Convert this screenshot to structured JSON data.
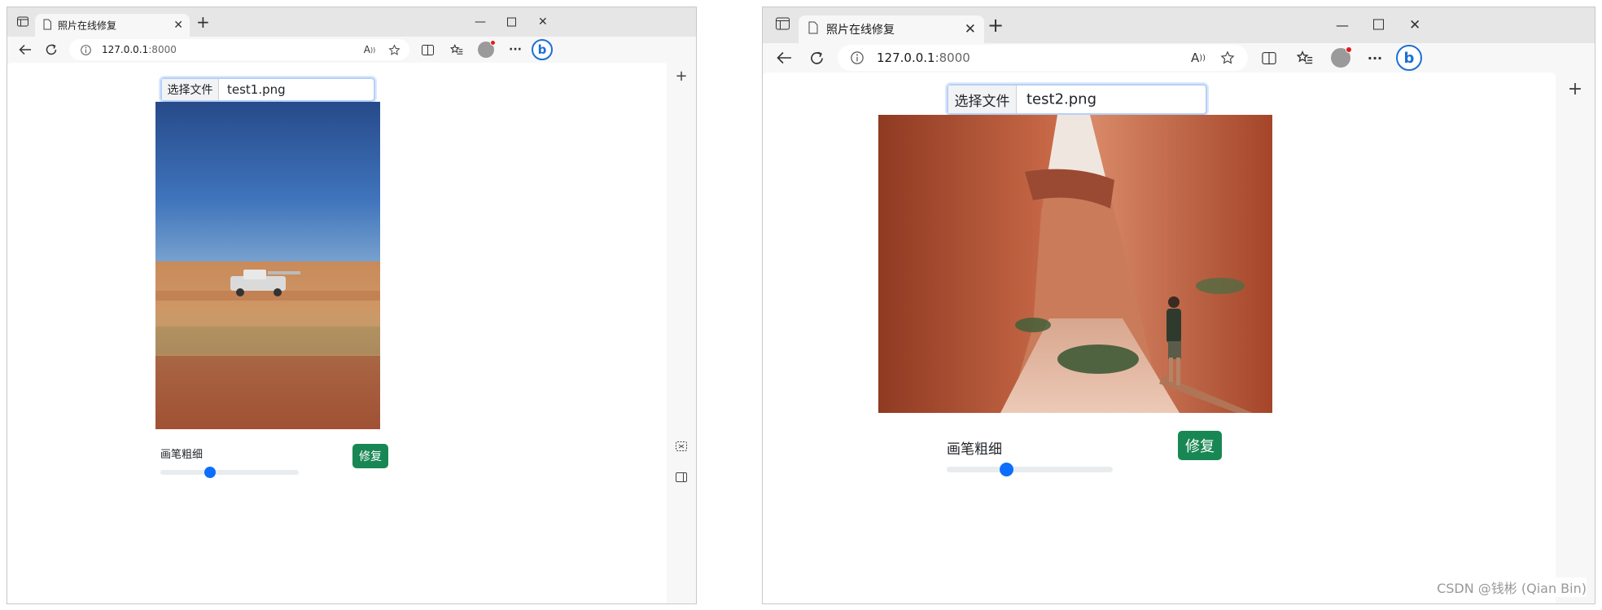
{
  "left_window": {
    "tab_title": "照片在线修复",
    "url_host": "127.0.0.1",
    "url_port": ":8000",
    "file_button_label": "选择文件",
    "file_name": "test1.png",
    "brush_label": "画笔粗细",
    "repair_button_label": "修复",
    "brush_value_fraction": 0.36
  },
  "right_window": {
    "tab_title": "照片在线修复",
    "url_host": "127.0.0.1",
    "url_port": ":8000",
    "file_button_label": "选择文件",
    "file_name": "test2.png",
    "brush_label": "画笔粗细",
    "repair_button_label": "修复",
    "brush_value_fraction": 0.36
  },
  "watermark": "CSDN @钱彬 (Qian Bin)",
  "icons": {
    "tab_actions": "tab-actions-icon",
    "page": "page-icon",
    "close": "close-icon",
    "new_tab": "plus-icon",
    "minimize": "minimize-icon",
    "maximize": "maximize-icon",
    "back": "back-arrow-icon",
    "refresh": "refresh-icon",
    "info": "info-icon",
    "read_aloud": "read-aloud-icon",
    "favorite": "star-icon",
    "split": "split-screen-icon",
    "favorites": "favorites-icon",
    "profile": "profile-avatar",
    "more": "more-icon",
    "bing": "bing-icon"
  },
  "colors": {
    "repair_button": "#198754",
    "slider_thumb": "#0d6efd",
    "file_focus_border": "#b6d0f7",
    "bing_blue": "#1b6fd6"
  }
}
